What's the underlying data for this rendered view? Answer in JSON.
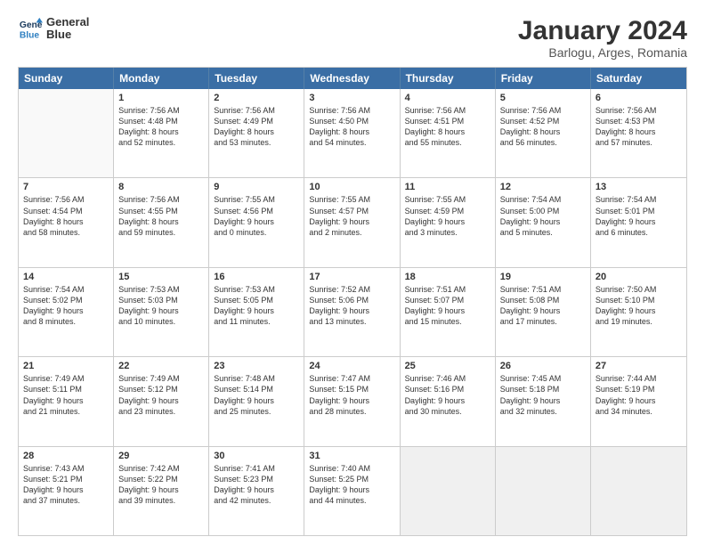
{
  "logo": {
    "line1": "General",
    "line2": "Blue"
  },
  "title": "January 2024",
  "subtitle": "Barlogu, Arges, Romania",
  "header_days": [
    "Sunday",
    "Monday",
    "Tuesday",
    "Wednesday",
    "Thursday",
    "Friday",
    "Saturday"
  ],
  "weeks": [
    [
      {
        "day": "",
        "info": ""
      },
      {
        "day": "1",
        "info": "Sunrise: 7:56 AM\nSunset: 4:48 PM\nDaylight: 8 hours\nand 52 minutes."
      },
      {
        "day": "2",
        "info": "Sunrise: 7:56 AM\nSunset: 4:49 PM\nDaylight: 8 hours\nand 53 minutes."
      },
      {
        "day": "3",
        "info": "Sunrise: 7:56 AM\nSunset: 4:50 PM\nDaylight: 8 hours\nand 54 minutes."
      },
      {
        "day": "4",
        "info": "Sunrise: 7:56 AM\nSunset: 4:51 PM\nDaylight: 8 hours\nand 55 minutes."
      },
      {
        "day": "5",
        "info": "Sunrise: 7:56 AM\nSunset: 4:52 PM\nDaylight: 8 hours\nand 56 minutes."
      },
      {
        "day": "6",
        "info": "Sunrise: 7:56 AM\nSunset: 4:53 PM\nDaylight: 8 hours\nand 57 minutes."
      }
    ],
    [
      {
        "day": "7",
        "info": "Sunrise: 7:56 AM\nSunset: 4:54 PM\nDaylight: 8 hours\nand 58 minutes."
      },
      {
        "day": "8",
        "info": "Sunrise: 7:56 AM\nSunset: 4:55 PM\nDaylight: 8 hours\nand 59 minutes."
      },
      {
        "day": "9",
        "info": "Sunrise: 7:55 AM\nSunset: 4:56 PM\nDaylight: 9 hours\nand 0 minutes."
      },
      {
        "day": "10",
        "info": "Sunrise: 7:55 AM\nSunset: 4:57 PM\nDaylight: 9 hours\nand 2 minutes."
      },
      {
        "day": "11",
        "info": "Sunrise: 7:55 AM\nSunset: 4:59 PM\nDaylight: 9 hours\nand 3 minutes."
      },
      {
        "day": "12",
        "info": "Sunrise: 7:54 AM\nSunset: 5:00 PM\nDaylight: 9 hours\nand 5 minutes."
      },
      {
        "day": "13",
        "info": "Sunrise: 7:54 AM\nSunset: 5:01 PM\nDaylight: 9 hours\nand 6 minutes."
      }
    ],
    [
      {
        "day": "14",
        "info": "Sunrise: 7:54 AM\nSunset: 5:02 PM\nDaylight: 9 hours\nand 8 minutes."
      },
      {
        "day": "15",
        "info": "Sunrise: 7:53 AM\nSunset: 5:03 PM\nDaylight: 9 hours\nand 10 minutes."
      },
      {
        "day": "16",
        "info": "Sunrise: 7:53 AM\nSunset: 5:05 PM\nDaylight: 9 hours\nand 11 minutes."
      },
      {
        "day": "17",
        "info": "Sunrise: 7:52 AM\nSunset: 5:06 PM\nDaylight: 9 hours\nand 13 minutes."
      },
      {
        "day": "18",
        "info": "Sunrise: 7:51 AM\nSunset: 5:07 PM\nDaylight: 9 hours\nand 15 minutes."
      },
      {
        "day": "19",
        "info": "Sunrise: 7:51 AM\nSunset: 5:08 PM\nDaylight: 9 hours\nand 17 minutes."
      },
      {
        "day": "20",
        "info": "Sunrise: 7:50 AM\nSunset: 5:10 PM\nDaylight: 9 hours\nand 19 minutes."
      }
    ],
    [
      {
        "day": "21",
        "info": "Sunrise: 7:49 AM\nSunset: 5:11 PM\nDaylight: 9 hours\nand 21 minutes."
      },
      {
        "day": "22",
        "info": "Sunrise: 7:49 AM\nSunset: 5:12 PM\nDaylight: 9 hours\nand 23 minutes."
      },
      {
        "day": "23",
        "info": "Sunrise: 7:48 AM\nSunset: 5:14 PM\nDaylight: 9 hours\nand 25 minutes."
      },
      {
        "day": "24",
        "info": "Sunrise: 7:47 AM\nSunset: 5:15 PM\nDaylight: 9 hours\nand 28 minutes."
      },
      {
        "day": "25",
        "info": "Sunrise: 7:46 AM\nSunset: 5:16 PM\nDaylight: 9 hours\nand 30 minutes."
      },
      {
        "day": "26",
        "info": "Sunrise: 7:45 AM\nSunset: 5:18 PM\nDaylight: 9 hours\nand 32 minutes."
      },
      {
        "day": "27",
        "info": "Sunrise: 7:44 AM\nSunset: 5:19 PM\nDaylight: 9 hours\nand 34 minutes."
      }
    ],
    [
      {
        "day": "28",
        "info": "Sunrise: 7:43 AM\nSunset: 5:21 PM\nDaylight: 9 hours\nand 37 minutes."
      },
      {
        "day": "29",
        "info": "Sunrise: 7:42 AM\nSunset: 5:22 PM\nDaylight: 9 hours\nand 39 minutes."
      },
      {
        "day": "30",
        "info": "Sunrise: 7:41 AM\nSunset: 5:23 PM\nDaylight: 9 hours\nand 42 minutes."
      },
      {
        "day": "31",
        "info": "Sunrise: 7:40 AM\nSunset: 5:25 PM\nDaylight: 9 hours\nand 44 minutes."
      },
      {
        "day": "",
        "info": ""
      },
      {
        "day": "",
        "info": ""
      },
      {
        "day": "",
        "info": ""
      }
    ]
  ]
}
